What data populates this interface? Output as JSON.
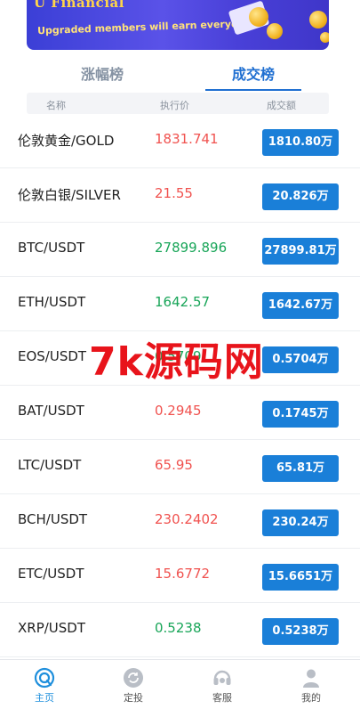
{
  "banner": {
    "title": "U Financial",
    "subtitle": "Upgraded members will earn everyday"
  },
  "tabs": [
    {
      "label": "涨幅榜"
    },
    {
      "label": "成交榜"
    }
  ],
  "header": {
    "name": "名称",
    "price": "执行价",
    "volume": "成交额"
  },
  "rows": [
    {
      "pair": "伦敦黄金/GOLD",
      "price": "1831.741",
      "trend": "red",
      "volume": "1810.80万"
    },
    {
      "pair": "伦敦白银/SILVER",
      "price": "21.55",
      "trend": "red",
      "volume": "20.826万"
    },
    {
      "pair": "BTC/USDT",
      "price": "27899.896",
      "trend": "green",
      "volume": "27899.81万"
    },
    {
      "pair": "ETH/USDT",
      "price": "1642.57",
      "trend": "green",
      "volume": "1642.67万"
    },
    {
      "pair": "EOS/USDT",
      "price": "0.5709",
      "trend": "green",
      "volume": "0.5704万"
    },
    {
      "pair": "BAT/USDT",
      "price": "0.2945",
      "trend": "red",
      "volume": "0.1745万"
    },
    {
      "pair": "LTC/USDT",
      "price": "65.95",
      "trend": "red",
      "volume": "65.81万"
    },
    {
      "pair": "BCH/USDT",
      "price": "230.2402",
      "trend": "red",
      "volume": "230.24万"
    },
    {
      "pair": "ETC/USDT",
      "price": "15.6772",
      "trend": "red",
      "volume": "15.6651万"
    },
    {
      "pair": "XRP/USDT",
      "price": "0.5238",
      "trend": "green",
      "volume": "0.5238万"
    }
  ],
  "watermark": "7k源码网",
  "nav": [
    {
      "label": "主页",
      "icon": "home-icon"
    },
    {
      "label": "定投",
      "icon": "invest-icon"
    },
    {
      "label": "客服",
      "icon": "support-icon"
    },
    {
      "label": "我的",
      "icon": "profile-icon"
    }
  ],
  "colors": {
    "accent": "#1f6fd1",
    "volume_button": "#1a7fd8",
    "up": "#18a558",
    "down": "#f0524f",
    "nav_active": "#1f8fdc"
  }
}
